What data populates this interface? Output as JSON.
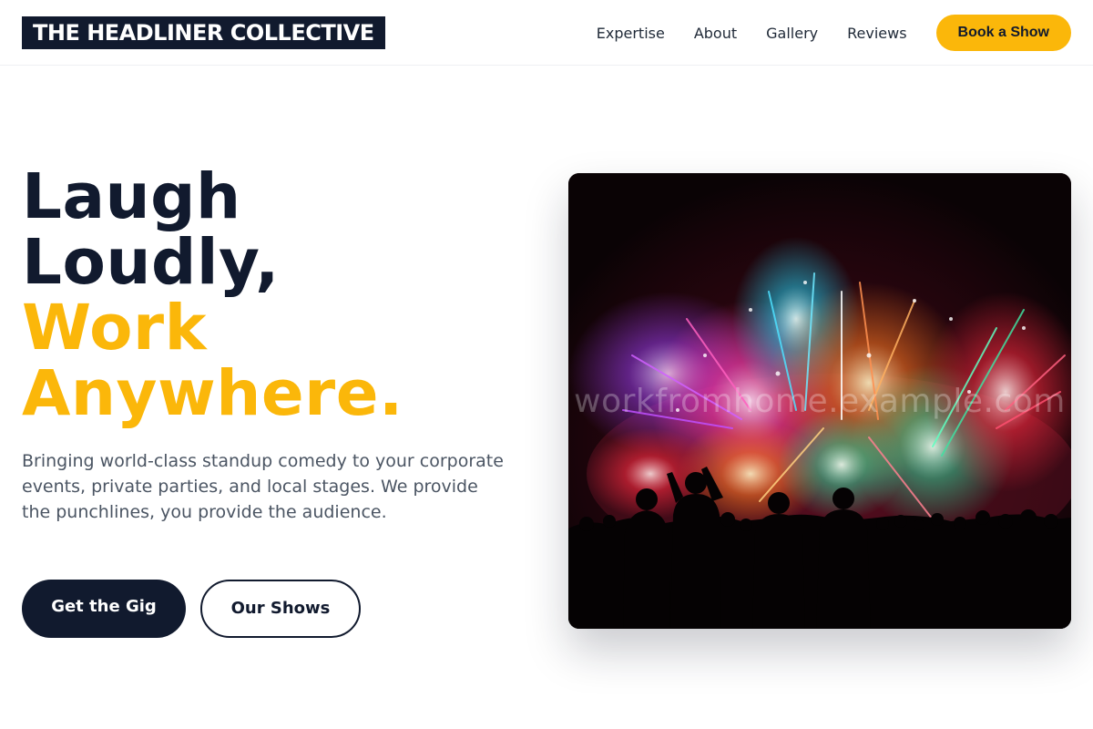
{
  "header": {
    "logo_text": "THE HEADLINER COLLECTIVE",
    "nav": [
      {
        "label": "Expertise"
      },
      {
        "label": "About"
      },
      {
        "label": "Gallery"
      },
      {
        "label": "Reviews"
      }
    ],
    "cta_label": "Book a Show"
  },
  "hero": {
    "title_lines": [
      "Laugh",
      "Loudly,",
      "Work",
      "Anywhere."
    ],
    "description": "Bringing world-class standup comedy to your corporate events, private parties, and local stages. We provide the punchlines, you provide the audience.",
    "primary_button": "Get the Gig",
    "secondary_button": "Our Shows",
    "image_watermark": "workfromhome.example.com"
  },
  "colors": {
    "navy": "#111a2e",
    "accent": "#fbb70a",
    "body_text": "#4b5563"
  },
  "icons": {
    "hero_image": "fireworks-crowd-photo"
  }
}
